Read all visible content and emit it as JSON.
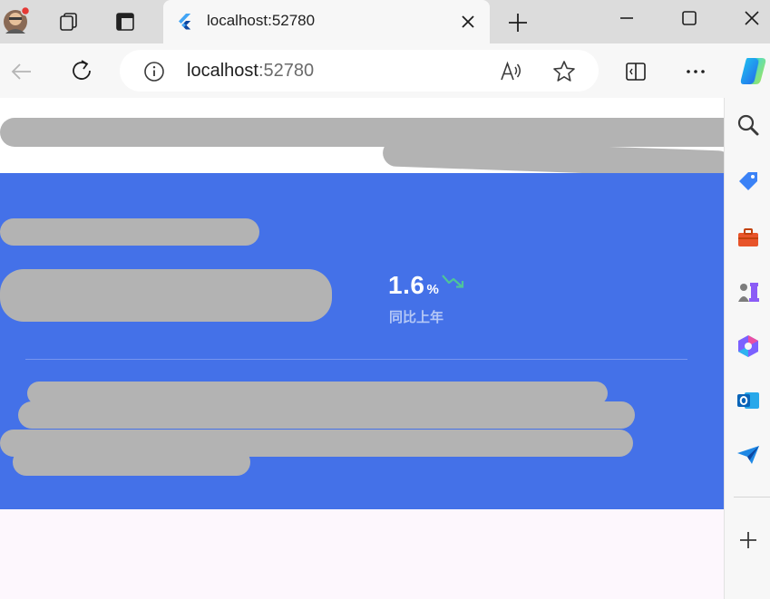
{
  "browser": {
    "tab": {
      "title": "localhost:52780",
      "favicon": "flutter-icon"
    },
    "address": {
      "host": "localhost",
      "port": ":52780"
    },
    "icons": {
      "back": "arrow-left-icon",
      "refresh": "refresh-icon",
      "info": "info-icon",
      "read_aloud": "read-aloud-icon",
      "favorite": "star-icon",
      "split": "split-screen-icon",
      "more": "ellipsis-icon",
      "copilot": "copilot-icon"
    },
    "sidebar": [
      "search-icon",
      "tag-icon",
      "toolbox-icon",
      "games-icon",
      "microsoft365-icon",
      "outlook-icon",
      "send-icon",
      "plus-icon"
    ]
  },
  "page": {
    "stat": {
      "value": "1.6",
      "unit": "%",
      "label": "同比上年",
      "trend": "down",
      "trend_color": "#4fc49a"
    },
    "colors": {
      "card": "#4471e8",
      "redaction": "#b3b3b3"
    }
  }
}
